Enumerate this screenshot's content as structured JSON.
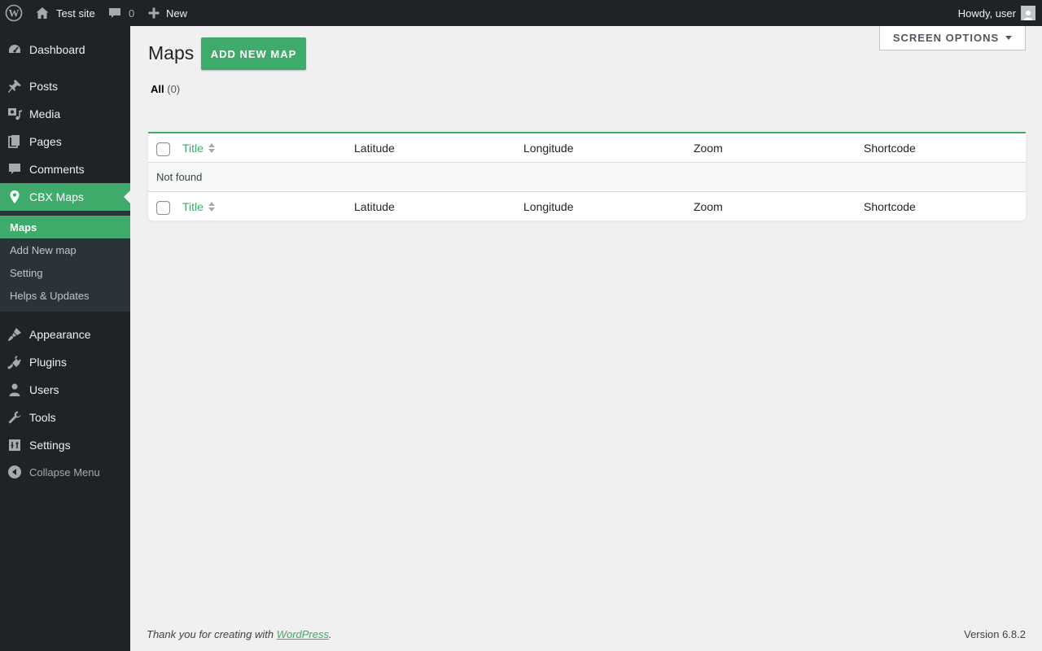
{
  "adminbar": {
    "site_name": "Test site",
    "comments_count": "0",
    "new_label": "New",
    "howdy": "Howdy, user"
  },
  "sidebar": {
    "items": [
      {
        "label": "Dashboard",
        "icon": "dashboard-icon"
      },
      {
        "label": "Posts",
        "icon": "pin-icon"
      },
      {
        "label": "Media",
        "icon": "media-icon"
      },
      {
        "label": "Pages",
        "icon": "pages-icon"
      },
      {
        "label": "Comments",
        "icon": "comment-icon"
      },
      {
        "label": "CBX Maps",
        "icon": "location-pin-icon"
      },
      {
        "label": "Appearance",
        "icon": "paintbrush-icon"
      },
      {
        "label": "Plugins",
        "icon": "plugin-icon"
      },
      {
        "label": "Users",
        "icon": "users-icon"
      },
      {
        "label": "Tools",
        "icon": "wrench-icon"
      },
      {
        "label": "Settings",
        "icon": "settings-icon"
      }
    ],
    "submenu": [
      "Maps",
      "Add New map",
      "Setting",
      "Helps & Updates"
    ],
    "collapse_label": "Collapse Menu"
  },
  "main": {
    "title": "Maps",
    "add_new_label": "ADD NEW MAP",
    "screen_options_label": "SCREEN OPTIONS",
    "filter_all": "All",
    "filter_all_count": "(0)",
    "columns": [
      "Title",
      "Latitude",
      "Longitude",
      "Zoom",
      "Shortcode"
    ],
    "empty_message": "Not found"
  },
  "footer": {
    "thanks_prefix": "Thank you for creating with ",
    "thanks_link": "WordPress",
    "thanks_suffix": ".",
    "version": "Version 6.8.2"
  },
  "colors": {
    "accent": "#3eab6a",
    "admin_dark": "#1d2327",
    "submenu_bg": "#2c3338",
    "page_bg": "#f0f0f1"
  }
}
